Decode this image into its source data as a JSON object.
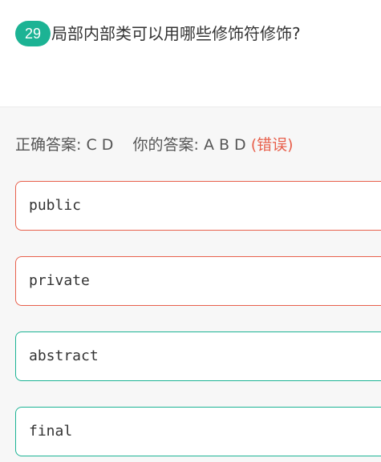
{
  "question": {
    "number": "29",
    "text": "局部内部类可以用哪些修饰符修饰?"
  },
  "answer": {
    "correct_label": "正确答案:",
    "correct_value": "C D",
    "yours_label": "你的答案:",
    "yours_value": "A B D",
    "verdict": "(错误)"
  },
  "options": [
    {
      "text": "public",
      "status": "incorrect-selected"
    },
    {
      "text": "private",
      "status": "incorrect-selected"
    },
    {
      "text": "abstract",
      "status": "correct"
    },
    {
      "text": "final",
      "status": "correct"
    }
  ],
  "colors": {
    "accent": "#1cb394",
    "error": "#e8604c"
  }
}
